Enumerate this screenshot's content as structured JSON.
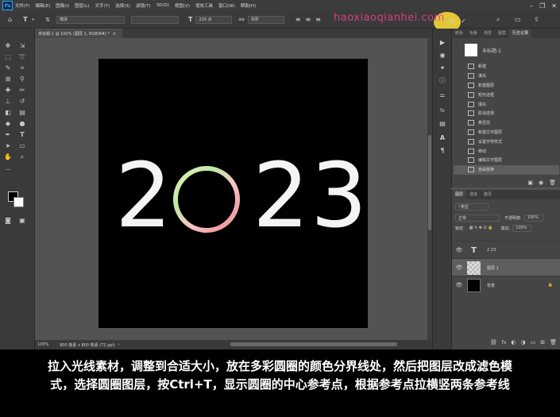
{
  "app": {
    "logo": "Ps"
  },
  "menubar": {
    "items": [
      "文件(F)",
      "编辑(E)",
      "图像(I)",
      "图层(L)",
      "文字(Y)",
      "选择(S)",
      "滤镜(T)",
      "3D(D)",
      "视图(V)",
      "增效工具",
      "窗口(W)",
      "帮助(H)"
    ],
    "window_controls": [
      "–",
      "❐",
      "✕"
    ]
  },
  "optionsbar": {
    "font_family": "楷体",
    "font_size": "229 点",
    "antialias": "浑厚",
    "icons": [
      "home-icon",
      "type-tool-icon",
      "text-orientation-icon",
      "align-left-icon",
      "align-center-icon",
      "align-right-icon",
      "color-swatch",
      "warp-text-icon",
      "character-panel-icon",
      "cancel-icon",
      "commit-icon"
    ]
  },
  "watermark": "haoxiaoqianhei.com",
  "document": {
    "tab_title": "未标题-1 @ 100% (图层 1, RGB/8#) *",
    "tab_close": "×"
  },
  "canvas": {
    "digits": [
      "2",
      "2",
      "3"
    ],
    "ring_colors": [
      "#e3f0b0",
      "#bfe8a8",
      "#f7c4c4",
      "#f19da4",
      "#f5d6a8"
    ]
  },
  "statusbar": {
    "zoom": "100%",
    "doc_size": "800 像素 x 800 像素 (72 ppi)",
    "arrow": "›"
  },
  "history_panel": {
    "tabs": [
      "颜色",
      "色板",
      "渐变",
      "图案",
      "历史记录"
    ],
    "active_tab": 4,
    "snapshot": "未标题-1",
    "items": [
      "新建",
      "填充",
      "新建图层",
      "矩形选框",
      "填充",
      "取消选择",
      "移至前",
      "新建文字图层",
      "设置字符样式",
      "移动",
      "编辑文字图层",
      "自由变换"
    ],
    "current_index": 11
  },
  "layers_panel": {
    "tabs": [
      "图层",
      "通道",
      "路径"
    ],
    "active_tab": 0,
    "filter_label": "类型",
    "blend_mode": "正常",
    "opacity_label": "不透明度:",
    "opacity_value": "100%",
    "lock_label": "锁定:",
    "fill_label": "填充:",
    "fill_value": "100%",
    "layers": [
      {
        "name": "2 23",
        "type": "text",
        "selected": false
      },
      {
        "name": "图层 1",
        "type": "pixel",
        "selected": true
      },
      {
        "name": "背景",
        "type": "background",
        "selected": false
      }
    ]
  },
  "subtitle": {
    "line1": "拉入光线素材，调整到合适大小，放在多彩圆圈的颜色分界线处，然后把图层改成滤色模",
    "line2": "式，选择圆圈图层，按Ctrl+T，显示圆圈的中心参考点，根据参考点拉横竖两条参考线"
  }
}
